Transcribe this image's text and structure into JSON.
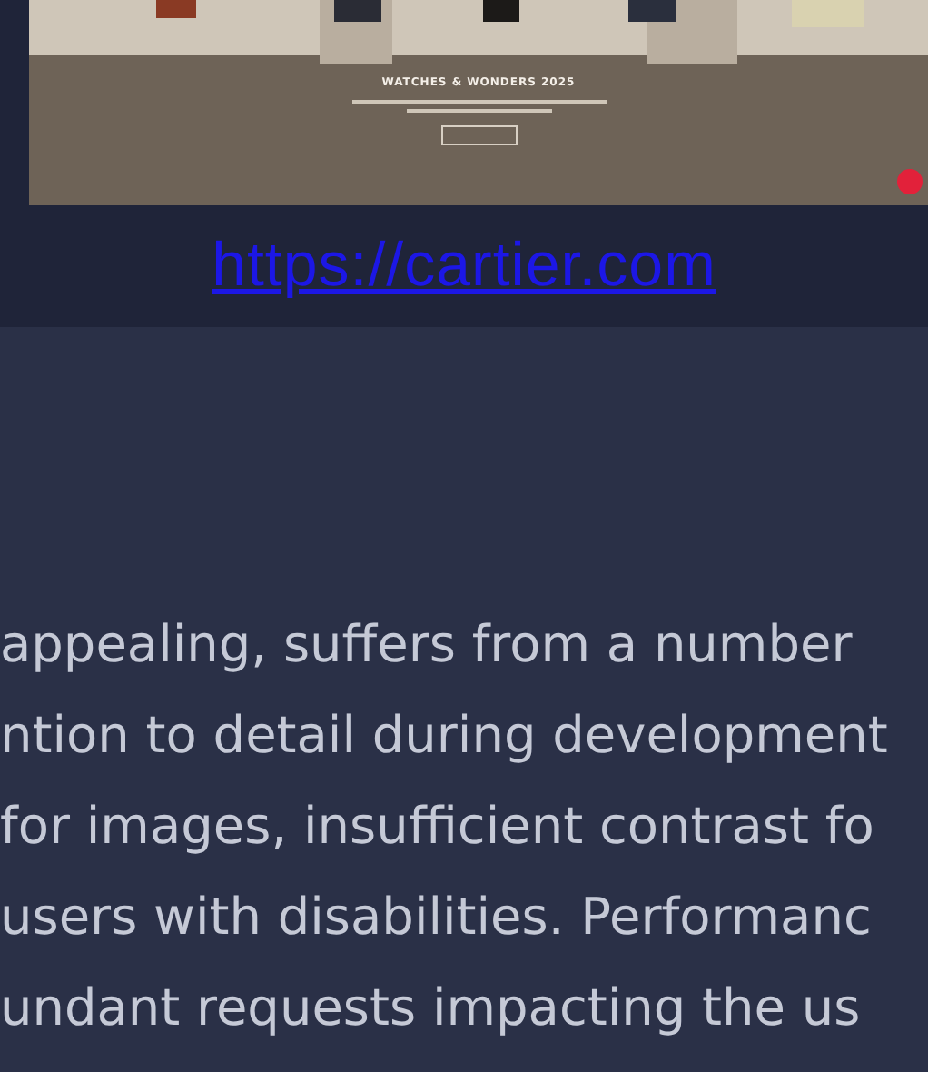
{
  "preview": {
    "headline": "WATCHES & WONDERS 2025"
  },
  "link": {
    "text": "https://cartier.com"
  },
  "paragraph": {
    "lines": [
      "appealing, suffers from a number",
      "ntion to detail during development",
      "for images, insufficient contrast fo",
      "users with disabilities. Performanc",
      "undant requests impacting the us"
    ]
  }
}
